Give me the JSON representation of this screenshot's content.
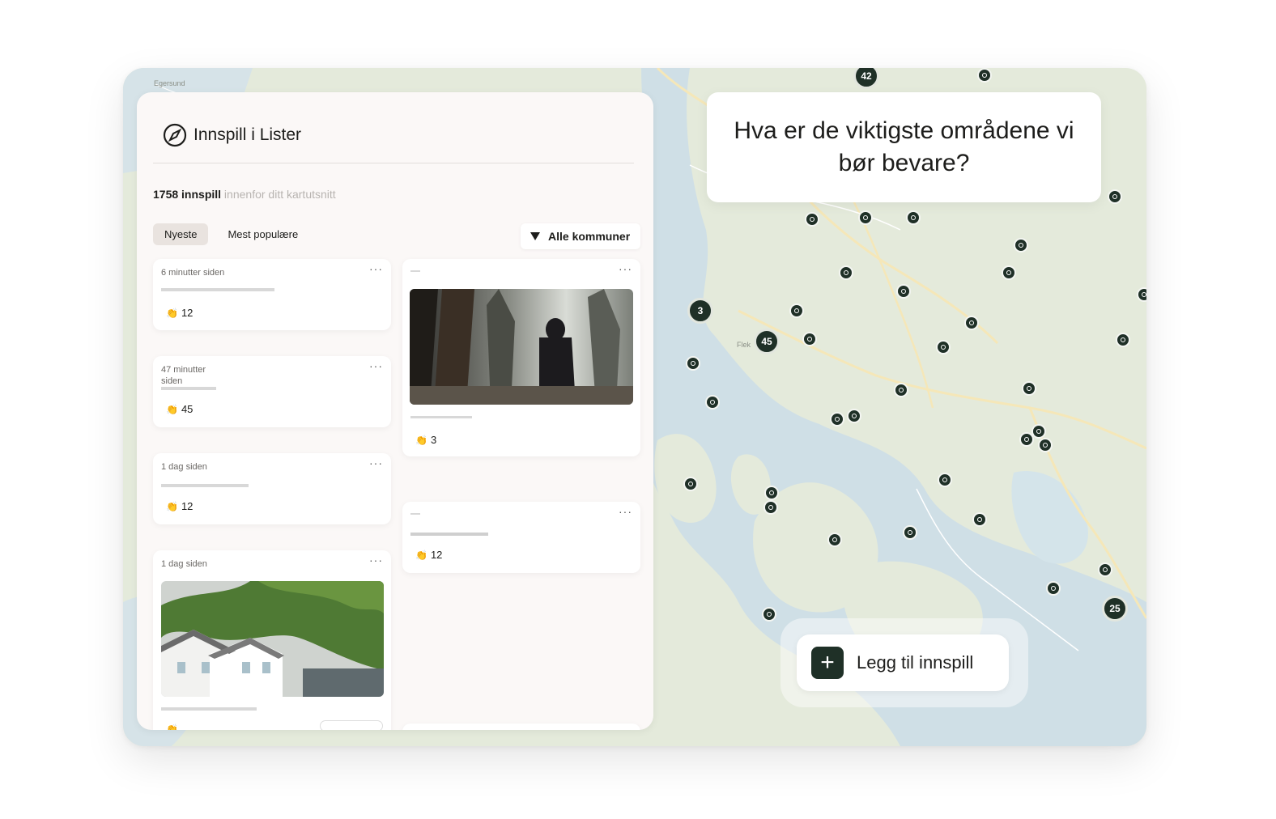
{
  "panel": {
    "title": "Innspill i Lister",
    "count_strong": "1758 innspill",
    "count_rest": " innenfor ditt kartutsnitt",
    "sort_tabs": [
      "Nyeste",
      "Mest populære"
    ],
    "filter_label": "Alle kommuner",
    "cards": [
      {
        "time": "6 minutter siden",
        "votes": "12"
      },
      {
        "time": "47 minutter\nsiden",
        "votes": "45"
      },
      {
        "time": "1 dag  siden",
        "votes": "12"
      },
      {
        "time": "1 dag siden",
        "votes": ""
      },
      {
        "time": "",
        "votes": "3"
      },
      {
        "time": "",
        "votes": "12"
      }
    ]
  },
  "question": "Hva er de viktigste områdene vi bør bevare?",
  "cta_label": "Legg til innspill",
  "map": {
    "labels": [
      "Egersund",
      "Flek"
    ],
    "clusters": [
      "42",
      "3",
      "45",
      "25"
    ]
  },
  "colors": {
    "marker": "#1f3027",
    "water": "#c9dce6",
    "land": "#e6ebdf",
    "panel": "#fbf8f7"
  }
}
